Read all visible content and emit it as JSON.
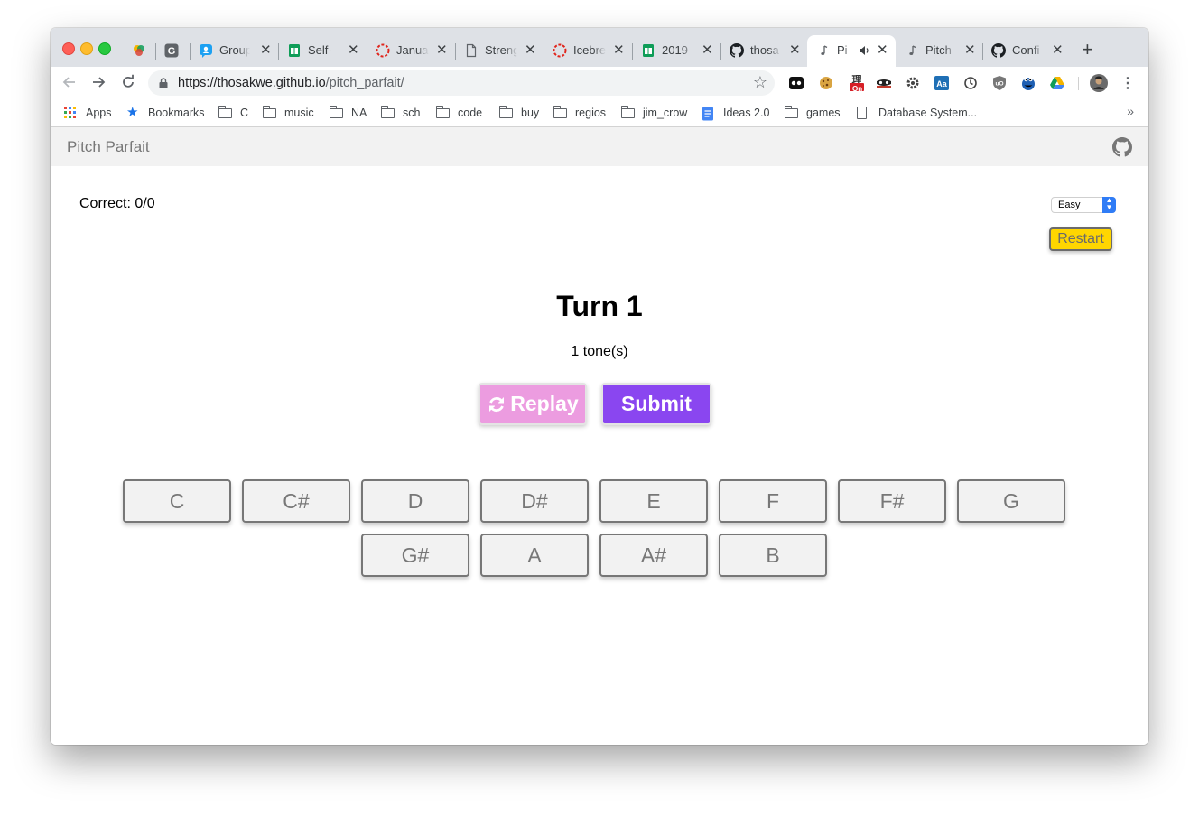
{
  "browser": {
    "tabs": [
      {
        "title": "",
        "icon": "multicolor-app-icon"
      },
      {
        "title": "",
        "icon": "g-icon"
      },
      {
        "title": "Group",
        "icon": "group-icon"
      },
      {
        "title": "Self-",
        "icon": "sheets-icon"
      },
      {
        "title": "Janua",
        "icon": "dashed-circle-icon"
      },
      {
        "title": "Streng",
        "icon": "document-icon"
      },
      {
        "title": "Icebre",
        "icon": "dashed-circle-icon"
      },
      {
        "title": "2019",
        "icon": "sheets-icon"
      },
      {
        "title": "thosa",
        "icon": "github-icon"
      },
      {
        "title": "Pi",
        "icon": "music-note-icon",
        "active": true
      },
      {
        "title": "Pitch",
        "icon": "music-note-icon"
      },
      {
        "title": "Confi",
        "icon": "github-icon"
      }
    ],
    "close_glyph": "✕",
    "new_tab_glyph": "+",
    "url_host": "https://thosakwe.github.io",
    "url_path": "/pitch_parfait/",
    "bookmarks": [
      {
        "label": "Apps",
        "icon": "apps-grid-icon"
      },
      {
        "label": "Bookmarks",
        "icon": "star-icon"
      },
      {
        "label": "C",
        "icon": "folder-icon"
      },
      {
        "label": "music",
        "icon": "folder-icon"
      },
      {
        "label": "NA",
        "icon": "folder-icon"
      },
      {
        "label": "sch",
        "icon": "folder-icon"
      },
      {
        "label": "code",
        "icon": "folder-icon"
      },
      {
        "label": "buy",
        "icon": "folder-icon"
      },
      {
        "label": "regios",
        "icon": "folder-icon"
      },
      {
        "label": "jim_crow",
        "icon": "folder-icon"
      },
      {
        "label": "Ideas 2.0",
        "icon": "docs-icon"
      },
      {
        "label": "games",
        "icon": "folder-icon"
      },
      {
        "label": "Database System...",
        "icon": "page-icon"
      }
    ],
    "more_bookmarks": "»",
    "extension_badge": "On"
  },
  "app": {
    "brand": "Pitch Parfait",
    "score": "Correct: 0/0",
    "difficulty": "Easy",
    "restart_label": "Restart",
    "turn": "Turn 1",
    "tones": "1 tone(s)",
    "replay_label": "Replay",
    "submit_label": "Submit",
    "notes_row1": [
      "C",
      "C#",
      "D",
      "D#",
      "E",
      "F",
      "F#",
      "G"
    ],
    "notes_row2": [
      "G#",
      "A",
      "A#",
      "B"
    ],
    "colors": {
      "replay": "#ec9ce0",
      "submit": "#8a46f0",
      "restart": "#ffd600"
    }
  }
}
